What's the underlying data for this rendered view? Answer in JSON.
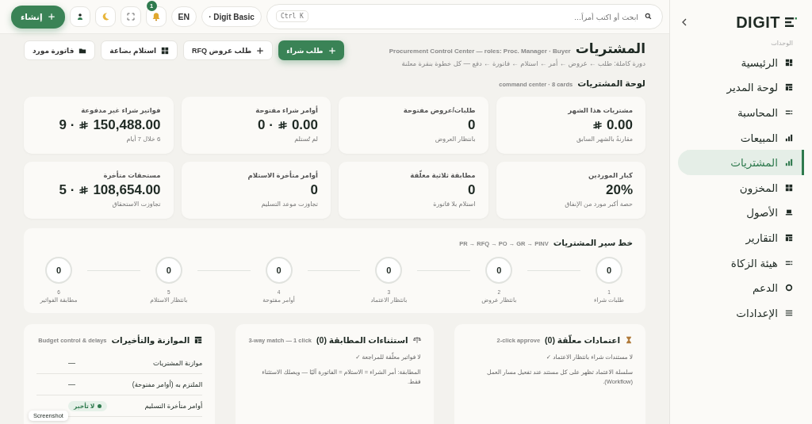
{
  "sidebar": {
    "logo": "DIGIT",
    "section_label": "الوحدات",
    "items": [
      {
        "label": "الرئيسية",
        "selected": false
      },
      {
        "label": "لوحة المدير",
        "selected": false
      },
      {
        "label": "المحاسبة",
        "selected": false
      },
      {
        "label": "المبيعات",
        "selected": false
      },
      {
        "label": "المشتريات",
        "selected": true
      },
      {
        "label": "المخزون",
        "selected": false
      },
      {
        "label": "الأصول",
        "selected": false
      },
      {
        "label": "التقارير",
        "selected": false
      },
      {
        "label": "هيئة الزكاة",
        "selected": false
      },
      {
        "label": "الدعم",
        "selected": false
      },
      {
        "label": "الإعدادات",
        "selected": false
      }
    ]
  },
  "topbar": {
    "search": {
      "placeholder": "ابحث أو اكتب أمراً...",
      "shortcut": "Ctrl K"
    },
    "plan": "· Digit Basic",
    "language": "EN",
    "notifications": "1",
    "create_button": "إنشاء"
  },
  "header": {
    "title": "المشتريات",
    "subtitle": "Procurement Control Center — roles: Proc. Manager · Buyer",
    "description": "دورة كاملة: طلب ← عروض ← أمر ← استلام ← فاتورة ← دفع — كل خطوة بنقرة معلنة",
    "actions": [
      {
        "label": "طلب شراء",
        "kind": "primary"
      },
      {
        "label": "طلب عروض RFQ",
        "kind": "secondary"
      },
      {
        "label": "استلام بضاعة",
        "kind": "secondary"
      },
      {
        "label": "فاتورة مورد",
        "kind": "secondary"
      }
    ]
  },
  "board": {
    "title": "لوحة المشتريات",
    "note": "command center · 8 cards",
    "cards": [
      {
        "kind": "money",
        "label": "مشتريات هذا الشهر",
        "value": "0.00",
        "sub": "مقارنةً بالشهر السابق"
      },
      {
        "kind": "number",
        "label": "طلبات/عروض مفتوحة",
        "value": "0",
        "sub": "بانتظار العروض"
      },
      {
        "kind": "money",
        "label": "أوامر شراء مفتوحة",
        "value": "0.00",
        "count": "· 0",
        "sub": "لم تُستلم"
      },
      {
        "kind": "money",
        "label": "فواتير شراء غير مدفوعة",
        "value": "150,488.00",
        "count": "· 9",
        "sub": "6 خلال 7 أيام"
      },
      {
        "kind": "number",
        "label": "كبار الموردين",
        "value": "20%",
        "sub": "حصة أكبر مورد من الإنفاق"
      },
      {
        "kind": "number",
        "label": "مطابقة ثلاثية معلّقة",
        "value": "0",
        "sub": "استلام بلا فاتورة"
      },
      {
        "kind": "number",
        "label": "أوامر متأخرة الاستلام",
        "value": "0",
        "sub": "تجاوزت موعد التسليم"
      },
      {
        "kind": "money",
        "label": "مستحقات متأخرة",
        "value": "108,654.00",
        "count": "· 5",
        "sub": "تجاوزت الاستحقاق"
      }
    ]
  },
  "pipeline": {
    "title": "خط سير المشتريات",
    "note": "PR → RFQ → PO → GR → PINV",
    "steps": [
      {
        "count": "0",
        "number": "1",
        "label": "طلبات شراء"
      },
      {
        "count": "0",
        "number": "2",
        "label": "بانتظار عروض"
      },
      {
        "count": "0",
        "number": "3",
        "label": "بانتظار الاعتماد"
      },
      {
        "count": "0",
        "number": "4",
        "label": "أوامر مفتوحة"
      },
      {
        "count": "0",
        "number": "5",
        "label": "بانتظار الاستلام"
      },
      {
        "count": "0",
        "number": "6",
        "label": "مطابقة الفواتير"
      }
    ]
  },
  "panels": [
    {
      "kind": "text",
      "title": "اعتمادات معلّقة (0)",
      "note": "2-click approve",
      "lines": [
        "لا مستندات شراء بانتظار الاعتماد ✓",
        "سلسلة الاعتماد تظهر على كل مستند عند تفعيل مسار العمل (Workflow)."
      ]
    },
    {
      "kind": "text",
      "title": "استثناءات المطابقة (0)",
      "note": "3-way match — 1 click",
      "lines": [
        "لا فواتير معلّقة للمراجعة ✓",
        "المطابقة: أمر الشراء = الاستلام = الفاتورة آليًا — ويصلك الاستثناء فقط."
      ]
    },
    {
      "kind": "rows",
      "title": "الموازنة والتأخيرات",
      "note": "Budget control & delays",
      "rows": [
        {
          "kind": "plain",
          "label": "موازنة المشتريات",
          "value": "—"
        },
        {
          "kind": "plain",
          "label": "الملتزم به (أوامر مفتوحة)",
          "value": "—"
        },
        {
          "kind": "status",
          "label": "أوامر متأخرة التسليم",
          "value": "لا تأخير"
        }
      ]
    }
  ],
  "tooltip": "Screenshot"
}
